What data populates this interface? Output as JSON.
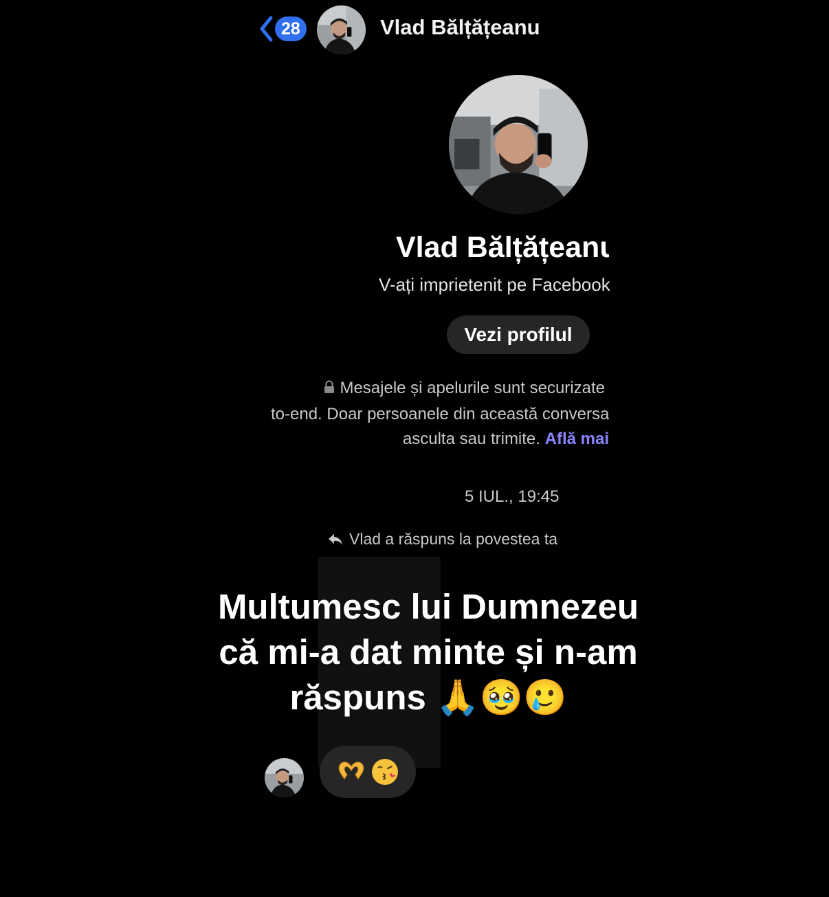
{
  "header": {
    "back_badge": "28",
    "contact_name": "Vlad Bălțățeanu"
  },
  "profile": {
    "name": "Vlad Bălțățeanu",
    "friend_status": "V-ați imprietenit pe Facebook",
    "view_profile_label": "Vezi profilul"
  },
  "encryption": {
    "line1": "Mesajele și apelurile sunt securizate",
    "line2": "to-end. Doar persoanele din această conversație",
    "line3_text": "asculta sau trimite.",
    "learn_more": "Află mai"
  },
  "thread": {
    "timestamp": "5 IUL., 19:45",
    "story_reply_notice": "Vlad a răspuns la povestea ta",
    "reaction_emojis": [
      "🫶",
      "😘"
    ]
  },
  "overlay_caption": {
    "line1": "Multumesc lui Dumnezeu",
    "line2": "că mi-a dat minte și n-am",
    "line3": "răspuns",
    "emojis": "🙏🥹🥲"
  },
  "colors": {
    "background": "#000000",
    "badge": "#2f6ff0",
    "button_bg": "#262626",
    "link": "#8a85ff"
  },
  "icons": {
    "back": "chevron-left-icon",
    "lock": "lock-icon",
    "reply": "reply-arrow-icon"
  }
}
